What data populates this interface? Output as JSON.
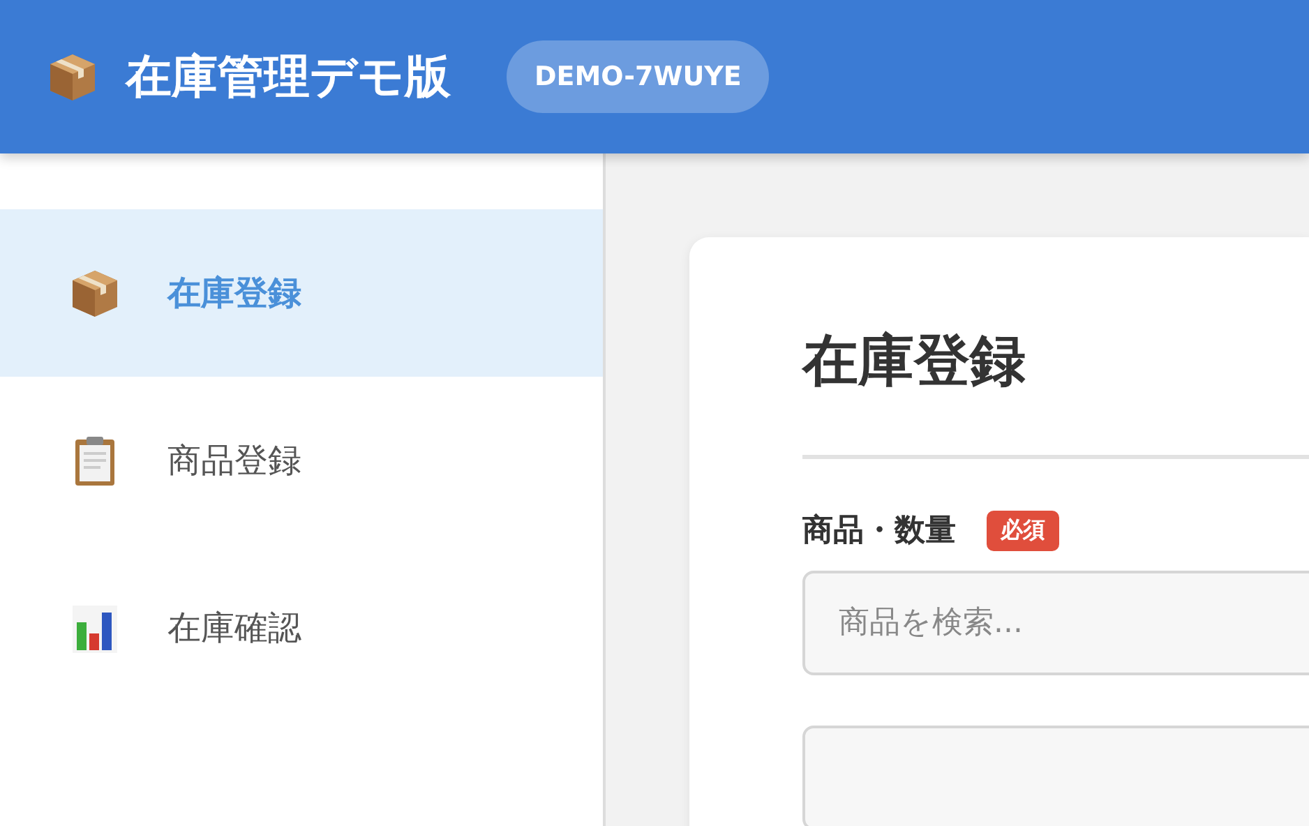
{
  "header": {
    "title": "在庫管理デモ版",
    "badge": "DEMO-7WUYE"
  },
  "sidebar": {
    "items": [
      {
        "label": "在庫登録",
        "selected": true
      },
      {
        "label": "商品登録",
        "selected": false
      },
      {
        "label": "在庫確認",
        "selected": false
      }
    ]
  },
  "form": {
    "title": "在庫登録",
    "fields": [
      {
        "label": "商品・数量",
        "required": true,
        "required_label": "必須",
        "placeholder": "商品を検索..."
      },
      {
        "required": false
      }
    ]
  }
}
